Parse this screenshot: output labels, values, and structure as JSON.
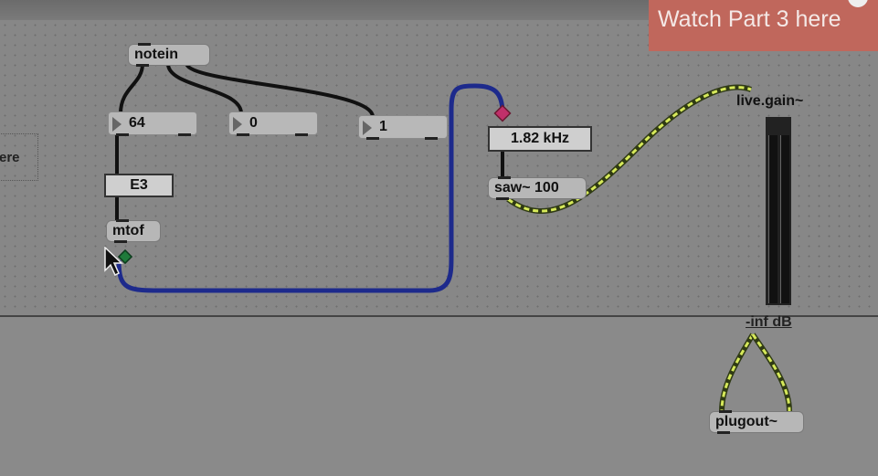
{
  "banner": {
    "text": "Watch Part 3 here"
  },
  "comment": {
    "text": "ere"
  },
  "objects": {
    "notein": "notein",
    "num64": "64",
    "num0": "0",
    "num1": "1",
    "note_msg": "E3",
    "mtof": "mtof",
    "freq_msg": "1.82 kHz",
    "saw": "saw~ 100",
    "gain_label": "live.gain~",
    "meter_readout": "-inf dB",
    "plugout": "plugout~"
  },
  "colors": {
    "patch_cord_signal": "#2a2f9a",
    "audio_cord": "#c9e04a",
    "banner": "#c0675c"
  }
}
